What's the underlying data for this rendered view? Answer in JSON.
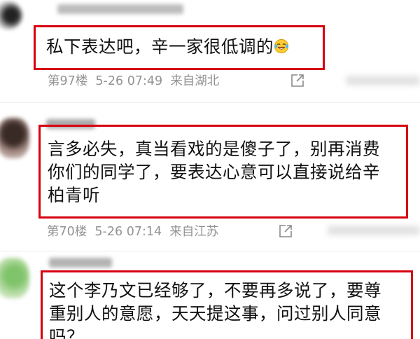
{
  "comments": [
    {
      "text": "私下表达吧，辛一家很低调的",
      "emoji": "laughing-crying-emoji",
      "floor": "第97楼",
      "date": "5-26",
      "time": "07:49",
      "location": "来自湖北"
    },
    {
      "username": "宋文生",
      "text": "言多必失，真当看戏的是傻子了，别再消费\n你们的同学了，要表达心意可以直接说给辛\n柏青听",
      "floor": "第70楼",
      "date": "5-26",
      "time": "07:14",
      "location": "来自江苏"
    },
    {
      "text": "这个李乃文已经够了，不要再多说了，要尊\n重别人的意愿，天天提这事，问过别人同意\n吗？"
    }
  ],
  "icons": {
    "share": "share-icon"
  },
  "colors": {
    "highlight_border": "#d7000f",
    "meta_text": "#939393",
    "comment_text": "#111111"
  }
}
